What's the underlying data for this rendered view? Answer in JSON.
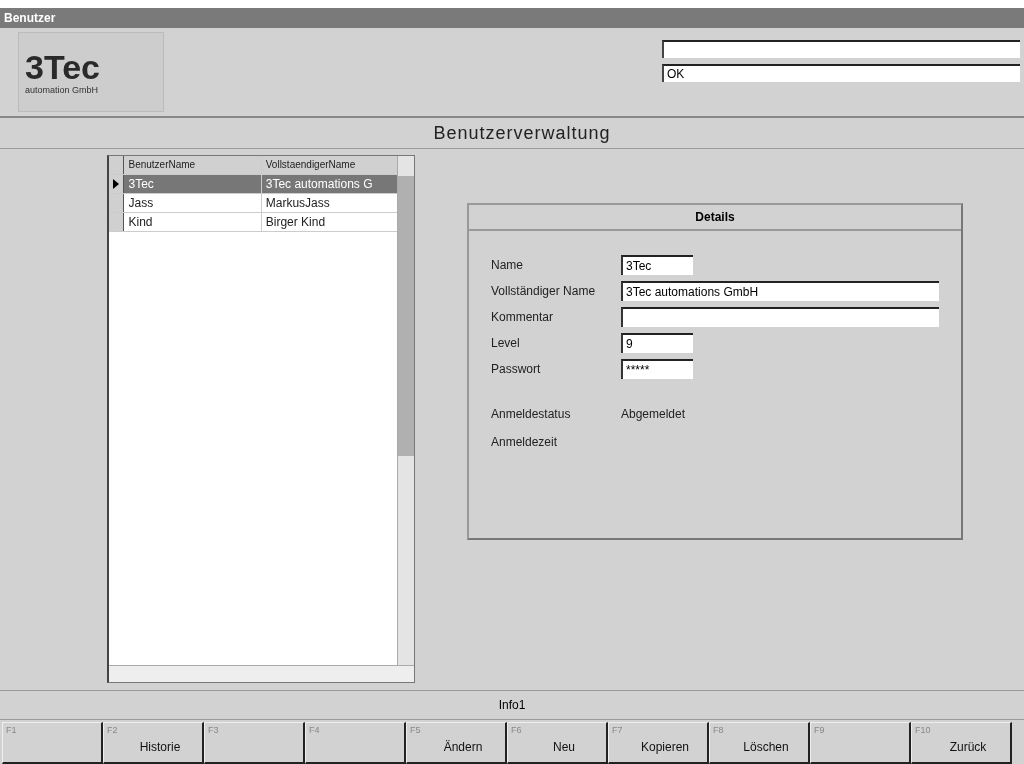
{
  "window": {
    "title": "Benutzer"
  },
  "logo": {
    "name": "3Tec",
    "subtitle": "automation GmbH"
  },
  "message_fields": [
    {
      "kind": "field"
    },
    {
      "kind": "field",
      "value": "OK"
    }
  ],
  "heading": "Benutzerverwaltung",
  "table": {
    "columns": [
      "BenutzerName",
      "VollstaendigerName"
    ],
    "rows": [
      {
        "cells": [
          "3Tec",
          "3Tec automations G"
        ],
        "selected": true
      },
      {
        "cells": [
          "Jass",
          "MarkusJass"
        ],
        "selected": false
      },
      {
        "cells": [
          "Kind",
          "Birger Kind"
        ],
        "selected": false
      }
    ]
  },
  "details": {
    "title": "Details",
    "fields": [
      {
        "label": "Name",
        "value": "3Tec",
        "kind": "short"
      },
      {
        "label": "Vollständiger Name",
        "value": "3Tec automations GmbH",
        "kind": "long"
      },
      {
        "label": "Kommentar",
        "kind": "long"
      },
      {
        "label": "Level",
        "value": "9",
        "kind": "short"
      },
      {
        "label": "Passwort",
        "value": "*****",
        "kind": "short"
      }
    ],
    "info": [
      {
        "label": "Anmeldestatus",
        "value": "Abgemeldet"
      },
      {
        "label": "Anmeldezeit"
      }
    ]
  },
  "status_bar": {
    "text": "Info1"
  },
  "function_keys": [
    {
      "key": "F1"
    },
    {
      "key": "F2",
      "label": "Historie"
    },
    {
      "key": "F3"
    },
    {
      "key": "F4"
    },
    {
      "key": "F5",
      "label": "Ändern"
    },
    {
      "key": "F6",
      "label": "Neu"
    },
    {
      "key": "F7",
      "label": "Kopieren"
    },
    {
      "key": "F8",
      "label": "Löschen"
    },
    {
      "key": "F9"
    },
    {
      "key": "F10",
      "label": "Zurück"
    }
  ]
}
